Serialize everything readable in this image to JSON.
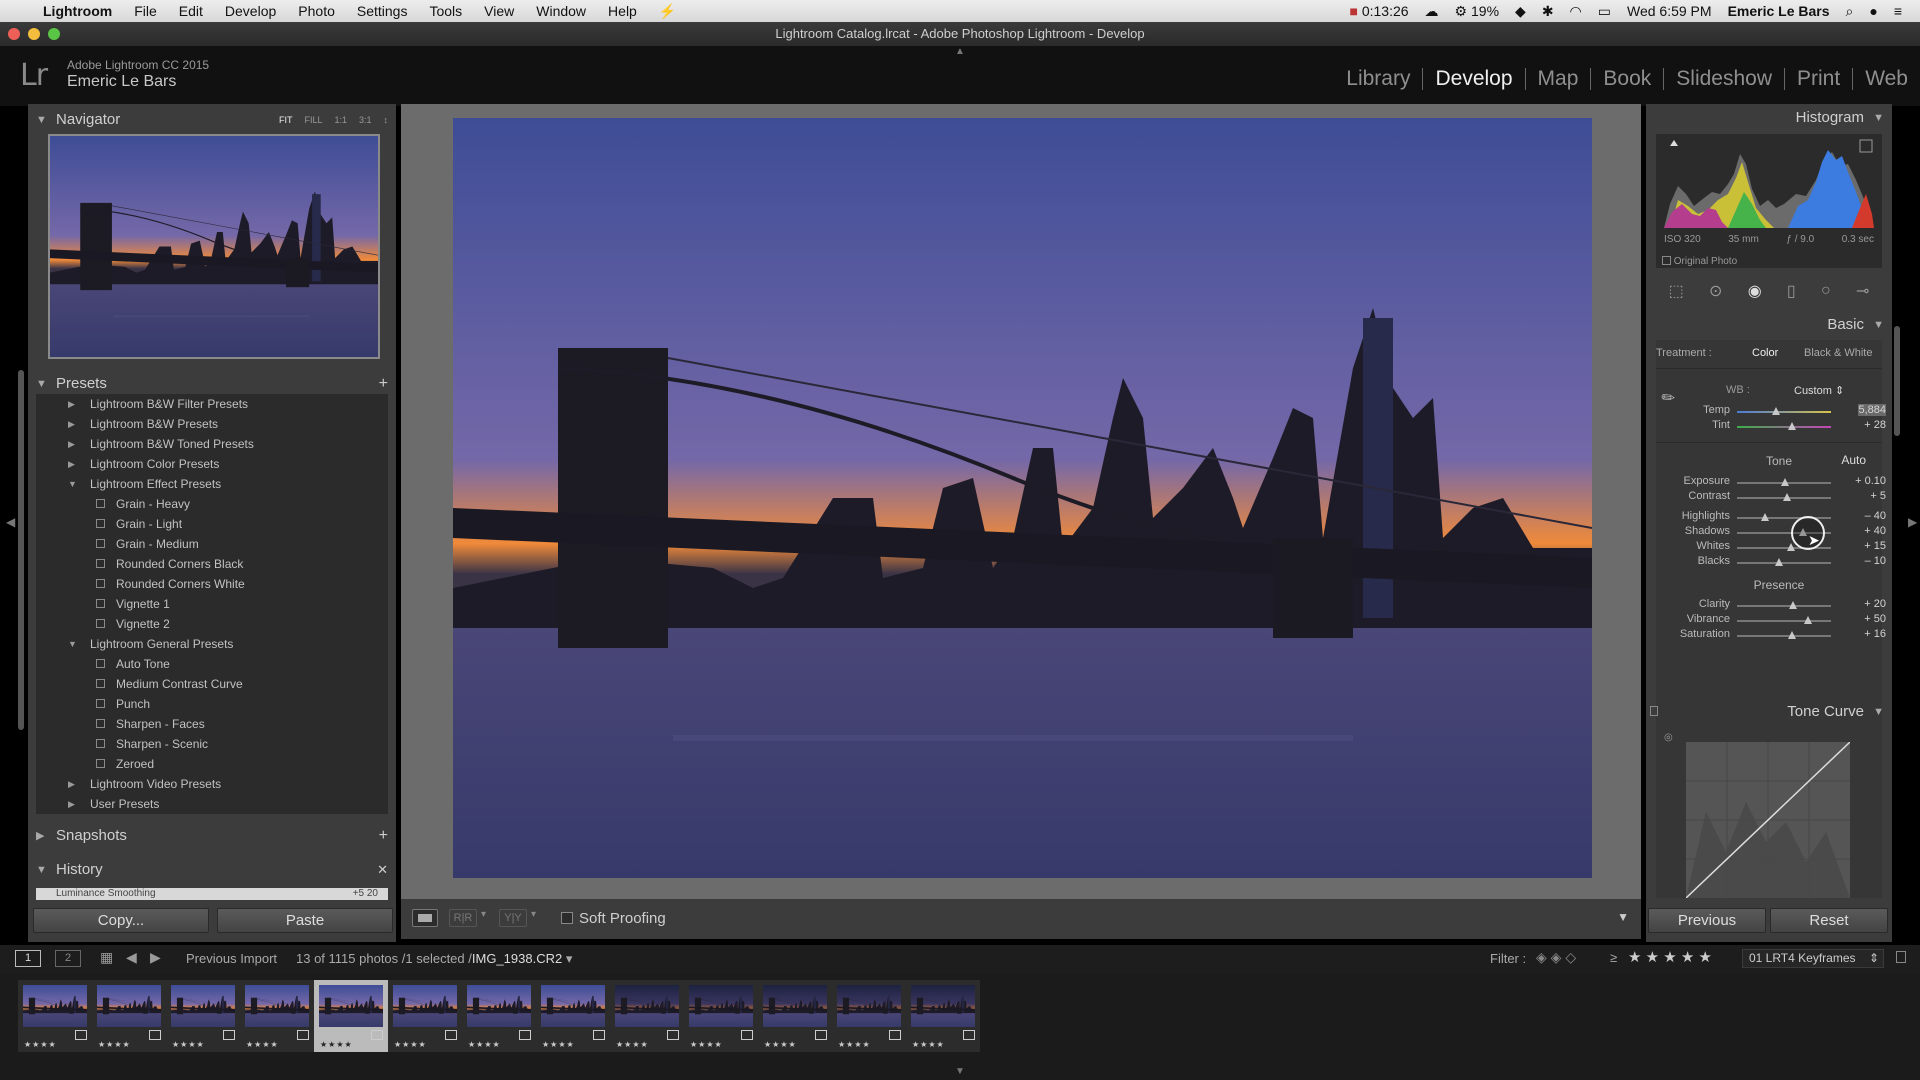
{
  "menubar": {
    "app": "Lightroom",
    "menus": [
      "File",
      "Edit",
      "Develop",
      "Photo",
      "Settings",
      "Tools",
      "View",
      "Window",
      "Help"
    ],
    "timer": "0:13:26",
    "battery": "19%",
    "datetime": "Wed 6:59 PM",
    "user": "Emeric Le Bars"
  },
  "window": {
    "title": "Lightroom Catalog.lrcat - Adobe Photoshop Lightroom - Develop"
  },
  "identity": {
    "logo": "Lr",
    "product": "Adobe Lightroom CC 2015",
    "user": "Emeric Le Bars"
  },
  "modules": [
    "Library",
    "Develop",
    "Map",
    "Book",
    "Slideshow",
    "Print",
    "Web"
  ],
  "active_module": "Develop",
  "left": {
    "navigator": {
      "title": "Navigator",
      "options": [
        "FIT",
        "FILL",
        "1:1",
        "3:1"
      ]
    },
    "presets": {
      "title": "Presets",
      "items": [
        {
          "label": "Lightroom B&W Filter Presets",
          "level": 0,
          "state": "collapsed"
        },
        {
          "label": "Lightroom B&W Presets",
          "level": 0,
          "state": "collapsed"
        },
        {
          "label": "Lightroom B&W Toned Presets",
          "level": 0,
          "state": "collapsed"
        },
        {
          "label": "Lightroom Color Presets",
          "level": 0,
          "state": "collapsed"
        },
        {
          "label": "Lightroom Effect Presets",
          "level": 0,
          "state": "expanded"
        },
        {
          "label": "Grain - Heavy",
          "level": 1,
          "state": "item"
        },
        {
          "label": "Grain - Light",
          "level": 1,
          "state": "item"
        },
        {
          "label": "Grain - Medium",
          "level": 1,
          "state": "item"
        },
        {
          "label": "Rounded Corners Black",
          "level": 1,
          "state": "item"
        },
        {
          "label": "Rounded Corners White",
          "level": 1,
          "state": "item"
        },
        {
          "label": "Vignette 1",
          "level": 1,
          "state": "item"
        },
        {
          "label": "Vignette 2",
          "level": 1,
          "state": "item"
        },
        {
          "label": "Lightroom General Presets",
          "level": 0,
          "state": "expanded"
        },
        {
          "label": "Auto Tone",
          "level": 1,
          "state": "item"
        },
        {
          "label": "Medium Contrast Curve",
          "level": 1,
          "state": "item"
        },
        {
          "label": "Punch",
          "level": 1,
          "state": "item"
        },
        {
          "label": "Sharpen - Faces",
          "level": 1,
          "state": "item"
        },
        {
          "label": "Sharpen - Scenic",
          "level": 1,
          "state": "item"
        },
        {
          "label": "Zeroed",
          "level": 1,
          "state": "item"
        },
        {
          "label": "Lightroom Video Presets",
          "level": 0,
          "state": "collapsed"
        },
        {
          "label": "User Presets",
          "level": 0,
          "state": "collapsed"
        }
      ]
    },
    "snapshots": {
      "title": "Snapshots"
    },
    "history": {
      "title": "History",
      "partial_row": "Luminance Smoothing",
      "partial_values": "+5 20"
    },
    "copy_label": "Copy...",
    "paste_label": "Paste"
  },
  "toolbar": {
    "soft_proofing": "Soft Proofing"
  },
  "right": {
    "histogram": {
      "title": "Histogram",
      "iso": "ISO 320",
      "focal": "35 mm",
      "aperture": "ƒ / 9.0",
      "shutter": "0.3 sec",
      "original_photo": "Original Photo"
    },
    "basic": {
      "title": "Basic",
      "treatment_label": "Treatment :",
      "treatment_color": "Color",
      "treatment_bw": "Black & White",
      "wb_label": "WB :",
      "wb_value": "Custom",
      "temp": {
        "label": "Temp",
        "value": "5,884",
        "level": 0.42
      },
      "tint": {
        "label": "Tint",
        "value": "+ 28",
        "level": 0.58
      },
      "tone_label": "Tone",
      "auto_label": "Auto",
      "tone": [
        {
          "label": "Exposure",
          "value": "+ 0.10",
          "level": 0.51
        },
        {
          "label": "Contrast",
          "value": "+ 5",
          "level": 0.53
        }
      ],
      "tone2": [
        {
          "label": "Highlights",
          "value": "– 40",
          "level": 0.3
        },
        {
          "label": "Shadows",
          "value": "+ 40",
          "level": 0.7
        },
        {
          "label": "Whites",
          "value": "+ 15",
          "level": 0.57
        },
        {
          "label": "Blacks",
          "value": "– 10",
          "level": 0.45
        }
      ],
      "presence_label": "Presence",
      "presence": [
        {
          "label": "Clarity",
          "value": "+ 20",
          "level": 0.6
        },
        {
          "label": "Vibrance",
          "value": "+ 50",
          "level": 0.75
        },
        {
          "label": "Saturation",
          "value": "+ 16",
          "level": 0.58
        }
      ]
    },
    "tone_curve": {
      "title": "Tone Curve"
    },
    "previous_label": "Previous",
    "reset_label": "Reset"
  },
  "filmbar": {
    "source": "Previous Import",
    "count": "13 of 1115 photos /1 selected /",
    "filename": "IMG_1938.CR2",
    "filter_label": "Filter :",
    "rating_op": "≥",
    "stars_filter": "★ ★ ★ ★ ★",
    "collection": "01 LRT4 Keyframes"
  },
  "filmstrip": {
    "count": 13,
    "selected_index": 4,
    "stars": "★★★★"
  },
  "colors": {
    "sky_top": "#3e4d96",
    "sky_mid": "#7468a8",
    "sunset": "#f08a3a",
    "water": "#363a6a"
  }
}
